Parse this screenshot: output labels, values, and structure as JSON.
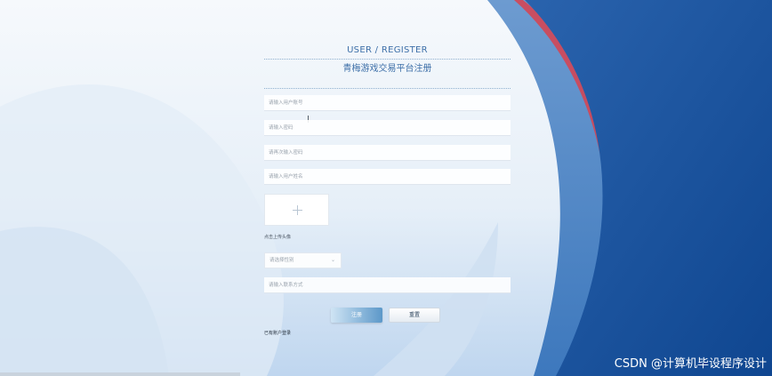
{
  "header": {
    "title_en": "USER / REGISTER",
    "title_cn": "青梅游戏交易平台注册"
  },
  "form": {
    "account_placeholder": "请输入用户账号",
    "password_placeholder": "请输入密码",
    "confirm_password_placeholder": "请再次输入密码",
    "name_placeholder": "请输入用户姓名",
    "avatar_hint": "点击上传头像",
    "gender_placeholder": "请选择性别",
    "contact_placeholder": "请输入联系方式"
  },
  "actions": {
    "register_label": "注册",
    "reset_label": "重置",
    "login_link": "已有账户登录"
  },
  "watermark": "CSDN @计算机毕设程序设计",
  "colors": {
    "accent": "#3d6fa8",
    "right_panel": "#1a4f97",
    "red_stripe": "#d9414d"
  }
}
